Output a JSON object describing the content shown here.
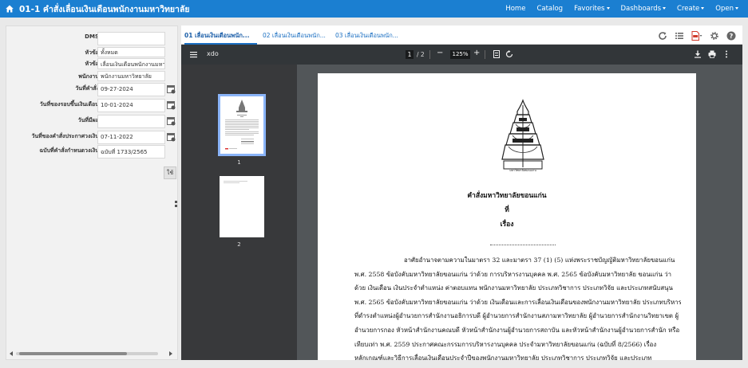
{
  "header": {
    "title": "01-1 คำสั่งเลื่อนเงินเดือนพนักงานมหาวิทยาลัย",
    "nav": [
      {
        "label": "Home",
        "dropdown": false
      },
      {
        "label": "Catalog",
        "dropdown": false
      },
      {
        "label": "Favorites",
        "dropdown": true
      },
      {
        "label": "Dashboards",
        "dropdown": true
      },
      {
        "label": "Create",
        "dropdown": true
      },
      {
        "label": "Open",
        "dropdown": true
      }
    ]
  },
  "filters": {
    "dms": {
      "label": "DMS",
      "value": ""
    },
    "subject1": {
      "label": "หัวข้อ",
      "value": "ทั้งหมด"
    },
    "subject2": {
      "label": "หัวข้อ",
      "value": "เลื่อนเงินเดือนพนักงานมหาวิทย"
    },
    "employee": {
      "label": "พนักงาน",
      "value": "พนักงานมหาวิทยาลัย"
    },
    "order_date": {
      "label": "วันที่คำสั่ง",
      "value": "09-27-2024"
    },
    "round_date": {
      "label": "วันที่ของรอบขึ้นเงินเดือน",
      "value": "10-01-2024"
    },
    "effective_date": {
      "label": "วันที่มีผล",
      "value": ""
    },
    "announce_date": {
      "label": "วันที่ของคำสั่งประกาศวงเงิน",
      "value": "07-11-2022"
    },
    "announce_no": {
      "label": "ฉบับที่คำสั่งกำหนดวงเงิน",
      "value": "ฉบับที่ 1733/2565"
    },
    "ok_label": "ใช้"
  },
  "tabs": [
    {
      "label": "01 เลื่อนเงินเดือนพนัก...",
      "active": true
    },
    {
      "label": "02 เลื่อนเงินเดือนพนัก...",
      "active": false
    },
    {
      "label": "03 เลื่อนเงินเดือนพนัก...",
      "active": false
    }
  ],
  "tool_icons": [
    "refresh-icon",
    "list-icon",
    "pdf-export-icon",
    "settings-icon",
    "help-icon"
  ],
  "viewer": {
    "file_name": "xdo",
    "current_page": "1",
    "page_total": "/ 2",
    "zoom": "125%",
    "thumb_labels": [
      "1",
      "2"
    ]
  },
  "document": {
    "heading": "คำสั่งมหาวิทยาลัยขอนแก่น",
    "line_no": "ที่",
    "line_subject": "เรื่อง",
    "seal_text": "มหาวิทยาลัยขอนแก่น",
    "paragraph": [
      "อาศัยอำนาจตามความในมาตรา 32 และมาตรา 37 (1) (5) แห่งพระราชบัญญัติมหาวิทยาลัยขอนแก่น",
      "พ.ศ. 2558 ข้อบังคับมหาวิทยาลัยขอนแก่น ว่าด้วย การบริหารงานบุคคล พ.ศ. 2565 ข้อบังคับมหาวิทยาลัย ขอนแก่น ว่า",
      "ด้วย เงินเดือน เงินประจำตำแหน่ง ค่าตอบแทน พนักงานมหาวิทยาลัย ประเภทวิชาการ ประเภทวิจัย และประเภทสนับสนุน",
      "พ.ศ. 2565 ข้อบังคับมหาวิทยาลัยขอนแก่น ว่าด้วย เงินเดือนและการเลื่อนเงินเดือนของพนักงานมหาวิทยาลัย ประเภทบริหาร",
      "ที่ดำรงตำแหน่งผู้อำนวยการสำนักงานอธิการบดี ผู้อำนวยการสำนักงานสภามหาวิทยาลัย ผู้อำนวยการสำนักงานวิทยาเขต ผู้",
      "อำนวยการกอง หัวหน้าสำนักงานคณบดี หัวหน้าสำนักงานผู้อำนวยการสถาบัน และหัวหน้าสำนักงานผู้อำนวยการสำนัก หรือ",
      "เทียบเท่า พ.ศ. 2559 ประกาศคณะกรรมการบริหารงานบุคคล ประจำมหาวิทยาลัยขอนแก่น (ฉบับที่ 8/2566) เรื่อง",
      "หลักเกณฑ์และวิธีการเลื่อนเงินเดือนประจำปีของพนักงานมหาวิทยาลัย ประเภทวิชาการ ประเภทวิจัย และประเภท"
    ]
  }
}
